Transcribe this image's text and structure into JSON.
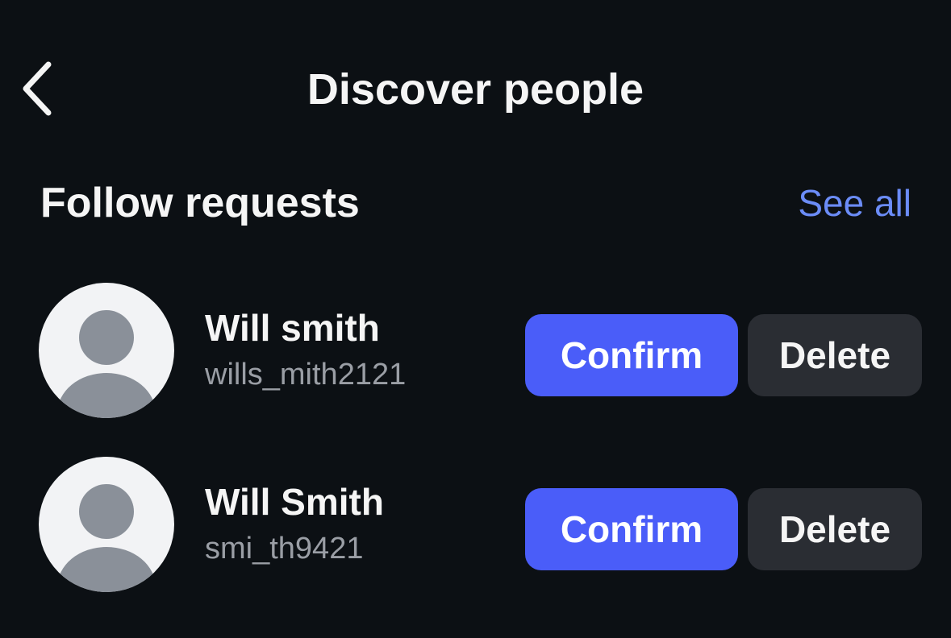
{
  "header": {
    "title": "Discover people",
    "back_icon": "chevron-left-icon"
  },
  "follow_requests": {
    "title": "Follow requests",
    "see_all_label": "See all",
    "see_all_color": "#6b8cf7",
    "items": [
      {
        "display_name": "Will smith",
        "username": "wills_mith2121",
        "avatar_icon": "default-avatar-icon",
        "confirm_label": "Confirm",
        "delete_label": "Delete"
      },
      {
        "display_name": "Will Smith",
        "username": "smi_th9421",
        "avatar_icon": "default-avatar-icon",
        "confirm_label": "Confirm",
        "delete_label": "Delete"
      }
    ]
  },
  "colors": {
    "background": "#0c1014",
    "confirm_button": "#4a5df9",
    "delete_button": "#2a2d33",
    "secondary_text": "#9a9ea5"
  }
}
